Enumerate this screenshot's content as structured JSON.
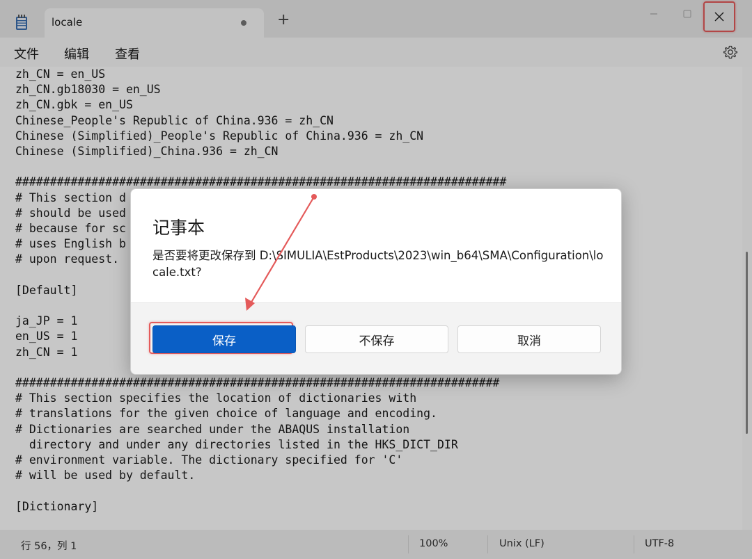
{
  "window": {
    "tab_title": "locale",
    "new_tab_glyph": "+",
    "minimize_glyph": "—",
    "maximize_glyph": "☐",
    "close_glyph": "✕"
  },
  "menu": {
    "file": "文件",
    "edit": "编辑",
    "view": "查看"
  },
  "editor": {
    "lines": [
      "zh_CN = en_US",
      "zh_CN.gb18030 = en_US",
      "zh_CN.gbk = en_US",
      "Chinese_People's Republic of China.936 = zh_CN",
      "Chinese (Simplified)_People's Republic of China.936 = zh_CN",
      "Chinese (Simplified)_China.936 = zh_CN",
      "",
      "#######################################################################",
      "# This section d",
      "# should be used",
      "# because for sc",
      "# uses English b",
      "# upon request.",
      "",
      "[Default]",
      "",
      "ja_JP = 1",
      "en_US = 1",
      "zh_CN = 1",
      "",
      "######################################################################",
      "# This section specifies the location of dictionaries with",
      "# translations for the given choice of language and encoding.",
      "# Dictionaries are searched under the ABAQUS installation",
      "  directory and under any directories listed in the HKS_DICT_DIR",
      "# environment variable. The dictionary specified for 'C'",
      "# will be used by default.",
      "",
      "[Dictionary]"
    ]
  },
  "status": {
    "position": "行 56，列 1",
    "zoom": "100%",
    "line_ending": "Unix (LF)",
    "encoding": "UTF-8"
  },
  "dialog": {
    "title": "记事本",
    "message": "是否要将更改保存到 D:\\SIMULIA\\EstProducts\\2023\\win_b64\\SMA\\Configuration\\locale.txt?",
    "save": "保存",
    "dont_save": "不保存",
    "cancel": "取消"
  },
  "colors": {
    "accent": "#0a5fc6",
    "annotation": "#e45a5a"
  }
}
